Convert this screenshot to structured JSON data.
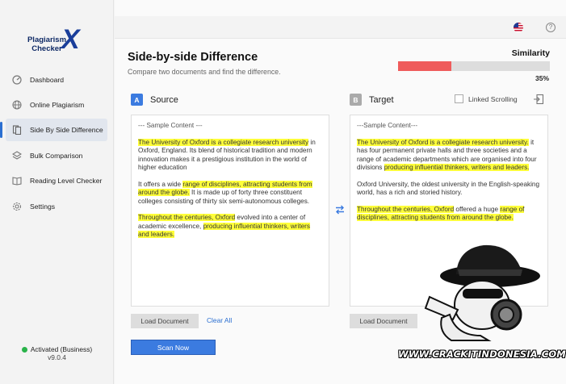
{
  "app": {
    "logo_line1": "Plagiarism",
    "logo_line2": "Checker"
  },
  "sidebar": {
    "items": [
      {
        "label": "Dashboard",
        "icon": "dashboard-icon"
      },
      {
        "label": "Online Plagiarism",
        "icon": "globe-icon"
      },
      {
        "label": "Side By Side Difference",
        "icon": "document-icon",
        "active": true
      },
      {
        "label": "Bulk Comparison",
        "icon": "layers-icon"
      },
      {
        "label": "Reading Level Checker",
        "icon": "book-icon"
      },
      {
        "label": "Settings",
        "icon": "gear-icon"
      }
    ],
    "status": "Activated (Business)",
    "version": "v9.0.4"
  },
  "page": {
    "title": "Side-by-side Difference",
    "subtitle": "Compare two documents and find the difference."
  },
  "similarity": {
    "label": "Similarity",
    "percent_text": "35%",
    "value": 0.35,
    "color": "#ef5b5b"
  },
  "source": {
    "badge": "A",
    "title": "Source",
    "header": "--- Sample Content ---",
    "p1_hl1": "The University of Oxford is a collegiate research university",
    "p1_rest": " in Oxford, England. Its blend of historical tradition and modern innovation makes it a prestigious institution in the world of higher education",
    "p2_pre": "It offers a wide ",
    "p2_hl1": "range of disciplines, attracting students from around the globe.",
    "p2_rest": " It is made up of forty three constituent colleges consisting of thirty six semi-autonomous colleges.",
    "p3_hl1": "Throughout the centuries, Oxford",
    "p3_mid": " evolved into a center of academic excellence, ",
    "p3_hl2": "producing influential thinkers, writers and leaders.",
    "load_label": "Load Document",
    "clear_label": "Clear All"
  },
  "target": {
    "badge": "B",
    "title": "Target",
    "header": "---Sample Content---",
    "p1_hl1": "The University of Oxford is a collegiate research university.",
    "p1_mid": " it has four permanent private halls and three societies and a range of academic departments which are organised into four divisions ",
    "p1_hl2": "producing influential thinkers, writers and leaders.",
    "p2": "Oxford University, the oldest university in the English-speaking world, has a rich and storied history.",
    "p3_hl1": "Throughout the centuries, Oxford",
    "p3_mid": " offered a huge ",
    "p3_hl2": "range of disciplines, attracting students from around the globe.",
    "load_label": "Load Document"
  },
  "linked_scrolling": "Linked Scrolling",
  "scan_label": "Scan Now",
  "watermark": "WWW.CRACKITINDONESIA.COM"
}
